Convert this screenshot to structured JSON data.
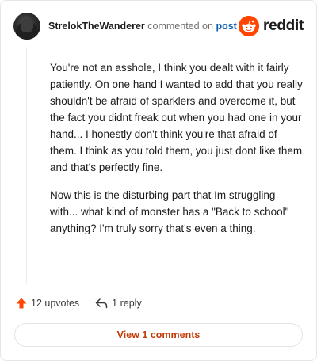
{
  "comment": {
    "username": "StrelokTheWanderer",
    "action": "commented on",
    "post_link": "post",
    "avatar_icon": "avatar",
    "paragraphs": [
      "You're not an asshole, I think you dealt with it fairly patiently. On one hand I wanted to add that you really shouldn't be afraid of sparklers and overcome it, but the fact you didnt freak out when you had one in your hand... I honestly don't think you're that afraid of them. I think as you told them, you just dont like them and that's perfectly fine.",
      "Now this is the disturbing part that Im struggling with... what kind of monster has a \"Back to school\" anything? I'm truly sorry that's even a thing."
    ],
    "upvotes_label": "12 upvotes",
    "reply_label": "1 reply",
    "view_comments_label": "View 1 comments"
  },
  "brand": {
    "name": "reddit",
    "logo_icon": "reddit-logo-icon",
    "accent_color": "#ff4500"
  },
  "icons": {
    "upvote": "upvote-arrow-icon",
    "reply": "reply-arrow-icon"
  },
  "colors": {
    "link": "#0b5fae",
    "upvote": "#ff4500",
    "view_comments_text": "#c23b0a"
  }
}
